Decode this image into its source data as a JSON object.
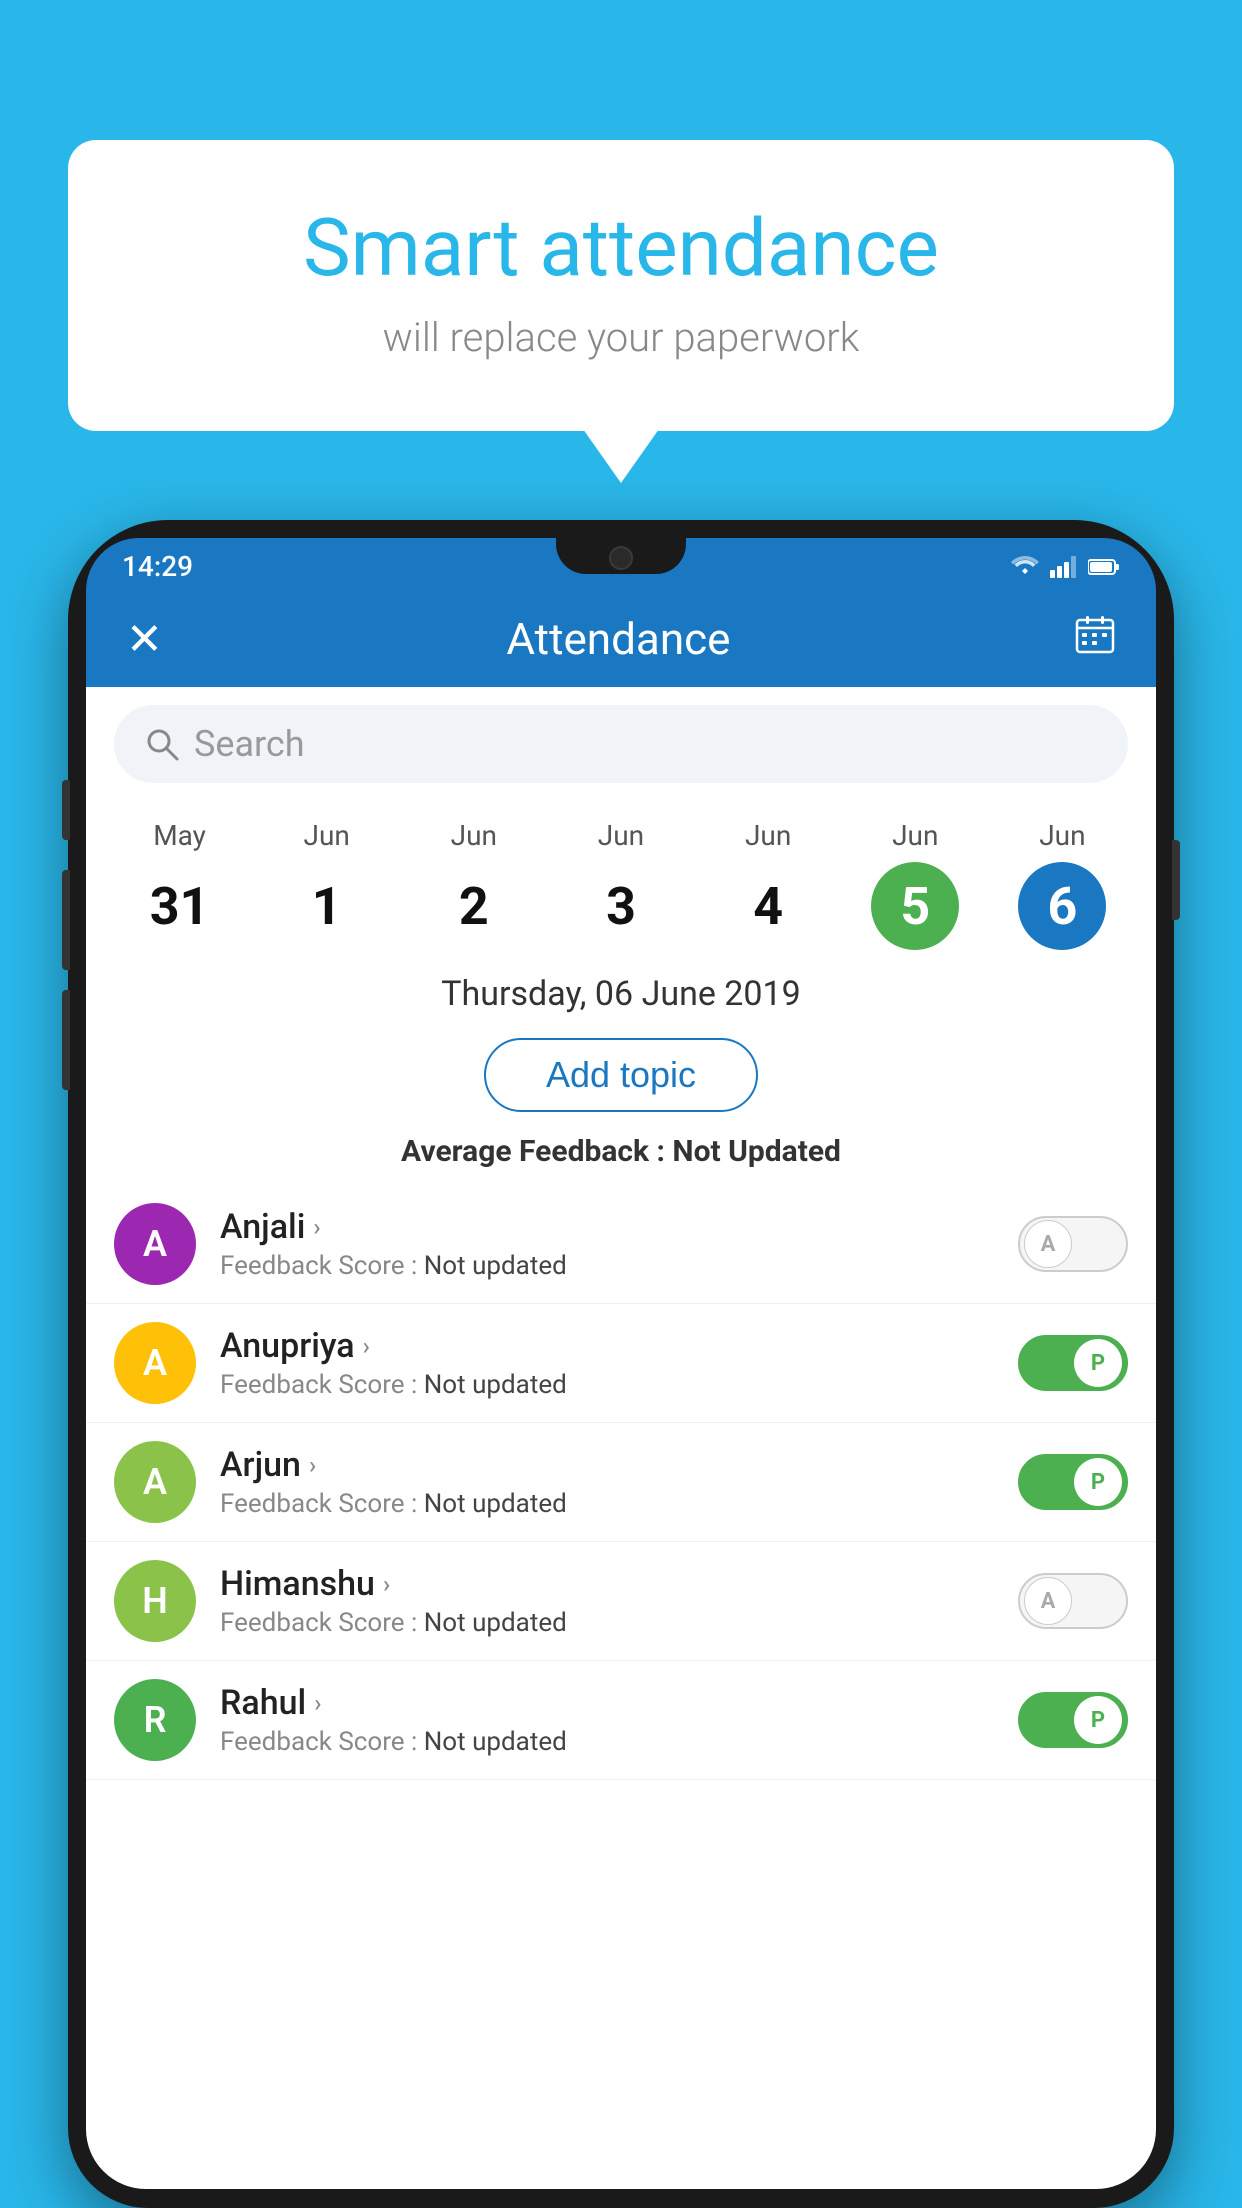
{
  "background_color": "#29b6e8",
  "bubble": {
    "title": "Smart attendance",
    "subtitle": "will replace your paperwork"
  },
  "phone": {
    "time": "14:29",
    "status_icons": [
      "wifi",
      "signal",
      "battery"
    ]
  },
  "app": {
    "header_title": "Attendance",
    "close_label": "✕",
    "calendar_icon": "📅"
  },
  "search": {
    "placeholder": "Search"
  },
  "calendar": {
    "days": [
      {
        "month": "May",
        "number": "31",
        "state": "normal"
      },
      {
        "month": "Jun",
        "number": "1",
        "state": "normal"
      },
      {
        "month": "Jun",
        "number": "2",
        "state": "normal"
      },
      {
        "month": "Jun",
        "number": "3",
        "state": "normal"
      },
      {
        "month": "Jun",
        "number": "4",
        "state": "normal"
      },
      {
        "month": "Jun",
        "number": "5",
        "state": "today"
      },
      {
        "month": "Jun",
        "number": "6",
        "state": "selected"
      }
    ],
    "selected_date": "Thursday, 06 June 2019"
  },
  "add_topic_label": "Add topic",
  "avg_feedback_label": "Average Feedback : ",
  "avg_feedback_value": "Not Updated",
  "students": [
    {
      "name": "Anjali",
      "initial": "A",
      "avatar_color": "#9c27b0",
      "feedback_label": "Feedback Score : ",
      "feedback_value": "Not updated",
      "toggle_state": "off",
      "toggle_label": "A"
    },
    {
      "name": "Anupriya",
      "initial": "A",
      "avatar_color": "#ffc107",
      "feedback_label": "Feedback Score : ",
      "feedback_value": "Not updated",
      "toggle_state": "present",
      "toggle_label": "P"
    },
    {
      "name": "Arjun",
      "initial": "A",
      "avatar_color": "#8bc34a",
      "feedback_label": "Feedback Score : ",
      "feedback_value": "Not updated",
      "toggle_state": "present",
      "toggle_label": "P"
    },
    {
      "name": "Himanshu",
      "initial": "H",
      "avatar_color": "#8bc34a",
      "feedback_label": "Feedback Score : ",
      "feedback_value": "Not updated",
      "toggle_state": "off",
      "toggle_label": "A"
    },
    {
      "name": "Rahul",
      "initial": "R",
      "avatar_color": "#4caf50",
      "feedback_label": "Feedback Score : ",
      "feedback_value": "Not updated",
      "toggle_state": "present",
      "toggle_label": "P"
    }
  ]
}
